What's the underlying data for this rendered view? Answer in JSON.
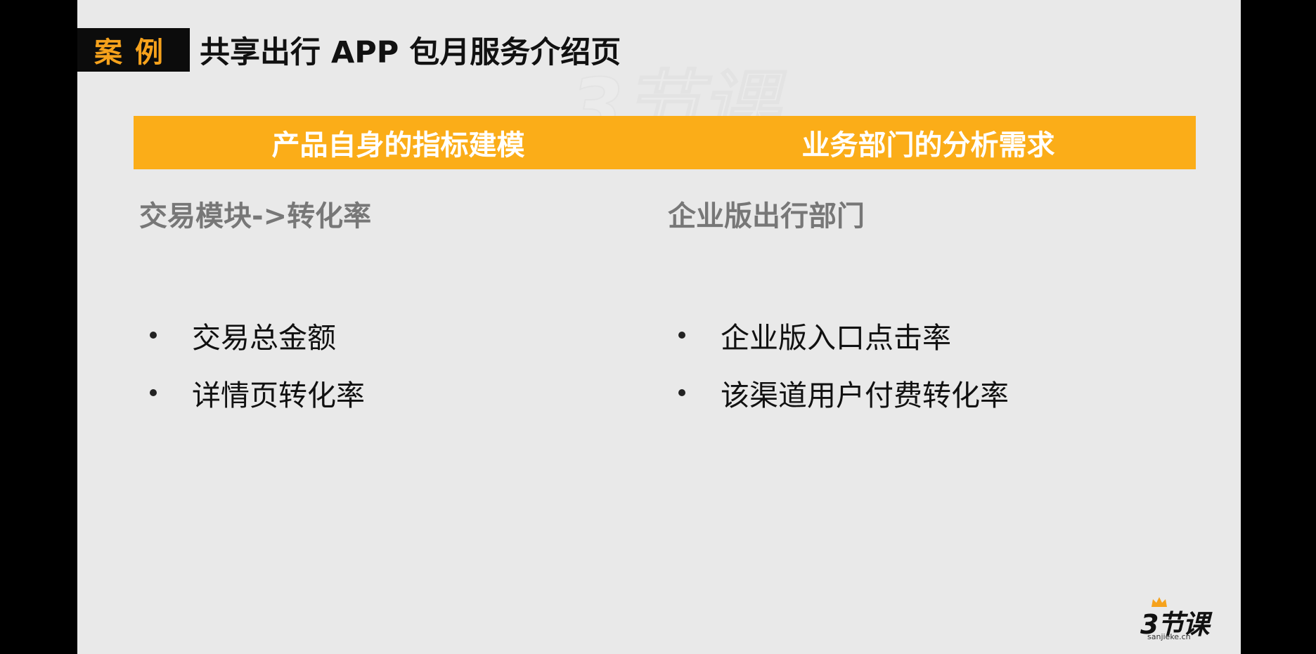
{
  "tag": {
    "label": "案例"
  },
  "title": "共享出行 APP 包月服务介绍页",
  "columns": [
    {
      "header": "产品自身的指标建模",
      "subtitle": "交易模块->转化率",
      "bullets": [
        "交易总金额",
        "详情页转化率"
      ]
    },
    {
      "header": "业务部门的分析需求",
      "subtitle": "企业版出行部门",
      "bullets": [
        "企业版入口点击率",
        "该渠道用户付费转化率"
      ]
    }
  ],
  "logo": {
    "main": "3节课",
    "sub": "sanjieke.cn"
  },
  "colors": {
    "accent": "#fbad18",
    "tag_bg": "#0c0c0c",
    "slide_bg": "#e9e9e9"
  }
}
